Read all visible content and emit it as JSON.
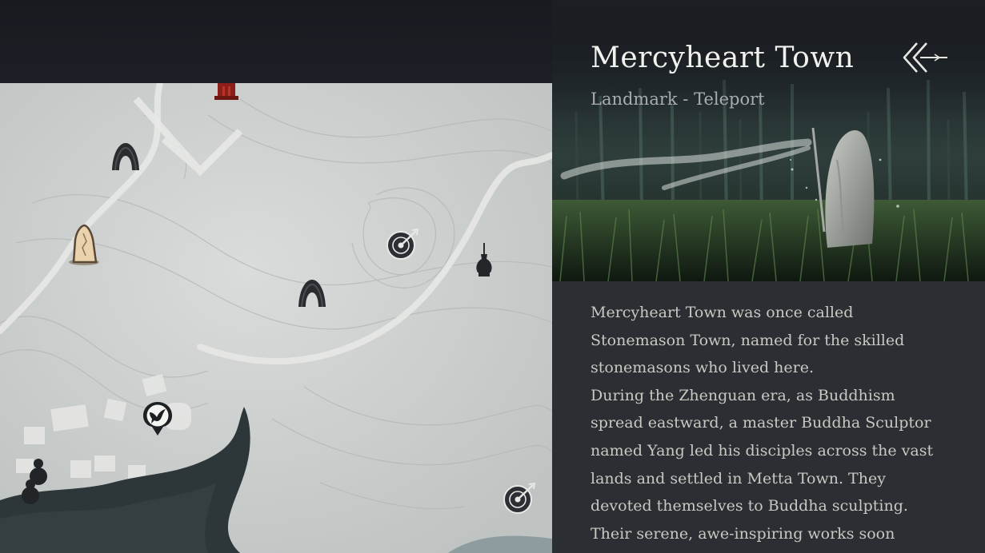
{
  "location": {
    "title": "Mercyheart Town",
    "subtitle": "Landmark - Teleport"
  },
  "description": {
    "paragraphs": [
      "Mercyheart Town was once called Stonemason Town, named for the skilled stonemasons who lived here.",
      "During the Zhenguan era, as Buddhism spread eastward, a master Buddha Sculptor named Yang led his disciples across the vast lands and settled in Metta Town. They devoted themselves to Buddha sculpting.",
      "Their serene, awe-inspiring works soon brought"
    ]
  },
  "map": {
    "markers": [
      {
        "name": "shrine-gate-marker",
        "icon": "red-shrine-gate-icon"
      },
      {
        "name": "cave-entrance-marker-1",
        "icon": "cave-entrance-icon"
      },
      {
        "name": "teleport-stone-marker",
        "icon": "teleport-stone-icon"
      },
      {
        "name": "target-challenge-marker-1",
        "icon": "target-dart-icon"
      },
      {
        "name": "incense-burner-marker",
        "icon": "incense-burner-icon"
      },
      {
        "name": "cave-entrance-marker-2",
        "icon": "cave-entrance-icon"
      },
      {
        "name": "bird-waypoint-marker",
        "icon": "bird-pin-icon"
      },
      {
        "name": "gourd-marker",
        "icon": "gourd-icon"
      },
      {
        "name": "target-challenge-marker-2",
        "icon": "target-dart-icon"
      }
    ]
  },
  "colors": {
    "panel_background": "#2b2e32",
    "title": "#f1f1ee",
    "subtitle": "#a9adb0",
    "body_text": "#c9c8c3",
    "map_paper": "#cfd2d1",
    "river": "#2d3638"
  }
}
